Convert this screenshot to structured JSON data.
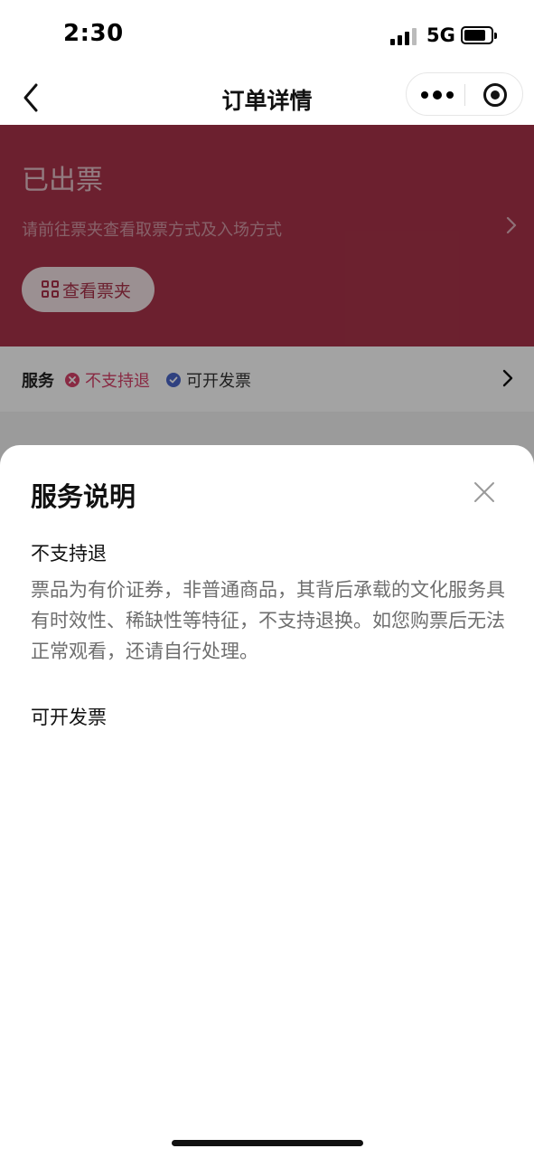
{
  "status_bar": {
    "time": "2:30",
    "network": "5G"
  },
  "nav": {
    "title": "订单详情"
  },
  "order": {
    "status": "已出票",
    "hint": "请前往票夹查看取票方式及入场方式",
    "ticket_button_label": "查看票夹"
  },
  "services": {
    "label": "服务",
    "items": [
      {
        "label": "不支持退",
        "color": "#d6426a"
      },
      {
        "label": "可开发票",
        "color": "#4a66c8"
      }
    ]
  },
  "sheet": {
    "title": "服务说明",
    "items": [
      {
        "title": "不支持退",
        "description": "票品为有价证券，非普通商品，其背后承载的文化服务具有时效性、稀缺性等特征，不支持退换。如您购票后无法正常观看，还请自行处理。"
      },
      {
        "title": "可开发票",
        "description": ""
      }
    ]
  },
  "colors": {
    "brand": "#a9334a",
    "overlay": "rgba(0,0,0,0.36)"
  }
}
